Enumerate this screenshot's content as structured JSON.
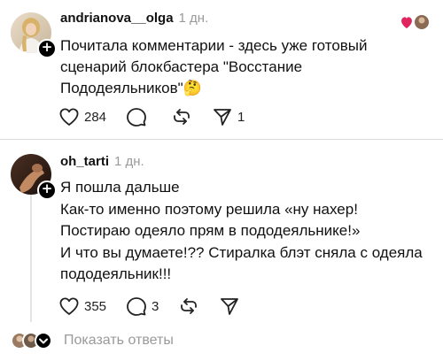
{
  "posts": [
    {
      "username": "andrianova__olga",
      "time": "1 дн.",
      "lines": [
        "Почитала комментарии - здесь уже готовый",
        "сценарий блокбастера \"Восстание",
        "Пододеяльников\"🤔"
      ],
      "likes": "284",
      "comments": "",
      "shares": "1"
    },
    {
      "username": "oh_tarti",
      "time": "1 дн.",
      "lines": [
        "Я пошла дальше",
        "Как-то именно поэтому решила «ну нахер!",
        "Постираю одеяло прям в пододеяльнике!»",
        "И что вы думаете!?? Стиралка блэт сняла с одеяла",
        "пододеяльник!!!"
      ],
      "likes": "355",
      "comments": "3",
      "shares": ""
    }
  ],
  "replies": {
    "label": "Показать ответы"
  },
  "icons": {
    "like": "heart-outline-icon",
    "comment": "comment-bubble-icon",
    "repost": "repost-arrows-icon",
    "share": "send-paper-plane-icon",
    "follow": "plus-icon"
  },
  "colors": {
    "text": "#111111",
    "muted": "#9a9a9a",
    "divider": "#dcdcdc",
    "heart": "#e0245e"
  }
}
